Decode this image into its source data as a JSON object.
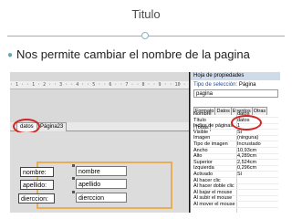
{
  "slide": {
    "title": "Titulo",
    "bullet": "Nos permite cambiar el nombre de la pagina"
  },
  "editor": {
    "ruler_text": "· 1 · · 1 · 2 · · 3 · · 4 · · 5 · · 6 · · 7 · · 8 · · 9 · · 10 · · 11 · · 12 ·",
    "tabs": [
      {
        "label": "datos"
      },
      {
        "label": "Página23"
      }
    ],
    "fields": [
      {
        "label": "nombre:",
        "control": "nombre"
      },
      {
        "label": "apellido:",
        "control": "apellido"
      },
      {
        "label": "dierccion:",
        "control": "dierccion"
      }
    ]
  },
  "property_sheet": {
    "title": "Hoja de propiedades",
    "selection_label": "Tipo de selección:",
    "selection_value": "Página",
    "selected_object": "pagina",
    "tabs": [
      "Formato",
      "Datos",
      "Eventos",
      "Otras",
      "Todas"
    ],
    "rows": [
      {
        "name": "Nombre",
        "value": "datos"
      },
      {
        "name": "Título",
        "value": "datos"
      },
      {
        "name": "Índice de páginas",
        "value": "1"
      },
      {
        "name": "Visible",
        "value": "Sí"
      },
      {
        "name": "Imagen",
        "value": "(ninguna)"
      },
      {
        "name": "Tipo de imagen",
        "value": "Incrustado"
      },
      {
        "name": "Ancho",
        "value": "10,93cm"
      },
      {
        "name": "Alto",
        "value": "4,289cm"
      },
      {
        "name": "Superior",
        "value": "2,524cm"
      },
      {
        "name": "Izquierda",
        "value": "0,296cm"
      },
      {
        "name": "Activado",
        "value": "Sí"
      },
      {
        "name": "Al hacer clic",
        "value": ""
      },
      {
        "name": "Al hacer doble clic",
        "value": ""
      },
      {
        "name": "Al bajar el mouse",
        "value": ""
      },
      {
        "name": "Al subir el mouse",
        "value": ""
      },
      {
        "name": "Al mover el mouse",
        "value": ""
      }
    ]
  },
  "colors": {
    "accent_rule": "#8ab6c0",
    "highlight_circle": "#d12525",
    "selection_frame": "#e8ad57"
  }
}
